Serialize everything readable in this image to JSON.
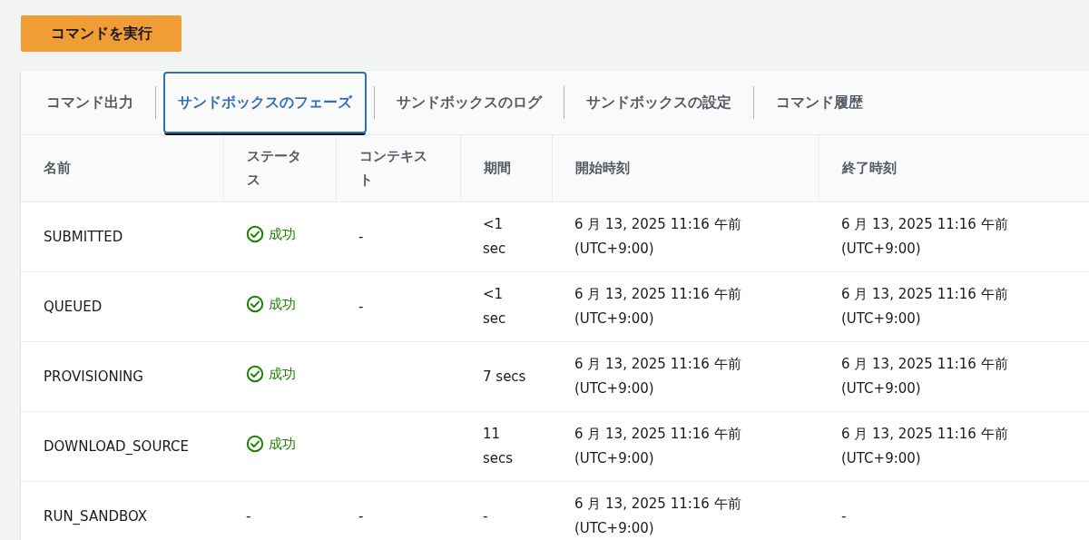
{
  "run_button": {
    "label": "コマンドを実行"
  },
  "tabs": [
    {
      "label": "コマンド出力",
      "selected": false
    },
    {
      "label": "サンドボックスのフェーズ",
      "selected": true
    },
    {
      "label": "サンドボックスのログ",
      "selected": false
    },
    {
      "label": "サンドボックスの設定",
      "selected": false
    },
    {
      "label": "コマンド履歴",
      "selected": false
    }
  ],
  "table": {
    "columns": [
      "名前",
      "ステータス",
      "コンテキスト",
      "期間",
      "開始時刻",
      "終了時刻"
    ],
    "rows": [
      {
        "name": "SUBMITTED",
        "status": {
          "kind": "success",
          "text": "成功"
        },
        "context": "-",
        "duration": "<1 sec",
        "start": [
          "6 月 13, 2025 11:16 午前",
          "(UTC+9:00)"
        ],
        "end": [
          "6 月 13, 2025 11:16 午前",
          "(UTC+9:00)"
        ]
      },
      {
        "name": "QUEUED",
        "status": {
          "kind": "success",
          "text": "成功"
        },
        "context": "-",
        "duration": "<1 sec",
        "start": [
          "6 月 13, 2025 11:16 午前",
          "(UTC+9:00)"
        ],
        "end": [
          "6 月 13, 2025 11:16 午前",
          "(UTC+9:00)"
        ]
      },
      {
        "name": "PROVISIONING",
        "status": {
          "kind": "success",
          "text": "成功"
        },
        "duration": "7 secs",
        "start": [
          "6 月 13, 2025 11:16 午前",
          "(UTC+9:00)"
        ],
        "end": [
          "6 月 13, 2025 11:16 午前",
          "(UTC+9:00)"
        ]
      },
      {
        "name": "DOWNLOAD_SOURCE",
        "status": {
          "kind": "success",
          "text": "成功"
        },
        "duration": "11 secs",
        "start": [
          "6 月 13, 2025 11:16 午前",
          "(UTC+9:00)"
        ],
        "end": [
          "6 月 13, 2025 11:16 午前",
          "(UTC+9:00)"
        ]
      },
      {
        "name": "RUN_SANDBOX",
        "status": {
          "kind": "none",
          "text": "-"
        },
        "context": "-",
        "duration": "-",
        "start": [
          "6 月 13, 2025 11:16 午前",
          "(UTC+9:00)"
        ],
        "end": [
          "-"
        ]
      }
    ]
  }
}
